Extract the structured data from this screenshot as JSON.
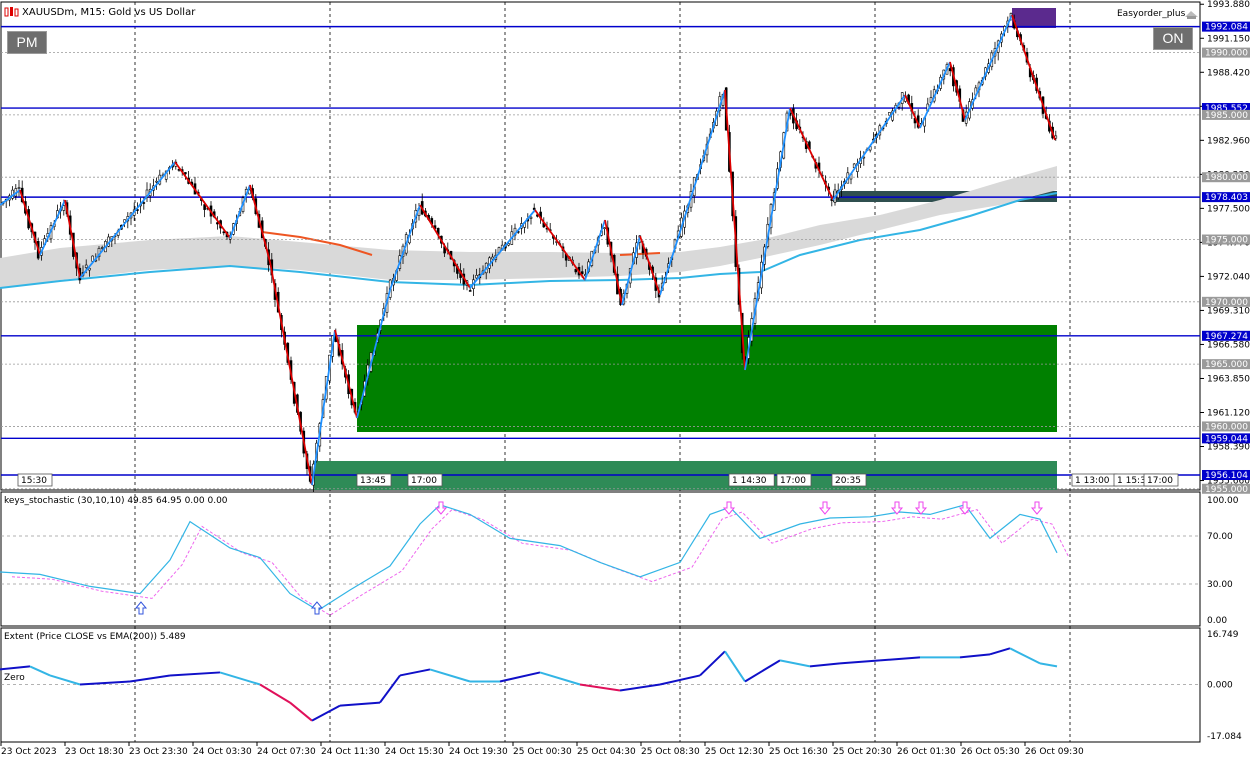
{
  "window": {
    "title": "XAUUSDm, M15:  Gold vs US Dollar",
    "expert": "Easyorder_plus",
    "pm_button": "PM",
    "on_button": "ON"
  },
  "colors": {
    "bull_candle": "#000000",
    "bear_candle": "#000000",
    "zigzag_up": "#1e90ff",
    "zigzag_down": "#dd0000",
    "level_line": "#0000cc",
    "demand_zone": "#008000",
    "demand_zone2": "#2e8b57",
    "supply_zone": "#5b2a8e",
    "zone_dark": "#2f4f4f",
    "ema": "#33b5e5",
    "stoch_main": "#33b5e5",
    "stoch_signal": "#ee66ee",
    "extent_up": "#1010c8",
    "extent_mid": "#33b5e5",
    "extent_down": "#e0105a"
  },
  "price_axis": {
    "labels": [
      "1993.880",
      "1991.150",
      "1988.420",
      "1985.690",
      "1982.960",
      "1980.230",
      "1977.500",
      "1974.770",
      "1972.040",
      "1969.310",
      "1966.580",
      "1963.850",
      "1961.120",
      "1958.390",
      "1955.660"
    ],
    "marked_levels": [
      {
        "price": "1992.084",
        "style": "blue"
      },
      {
        "price": "1990.000",
        "style": "gray"
      },
      {
        "price": "1985.552",
        "style": "blue"
      },
      {
        "price": "1985.000",
        "style": "gray"
      },
      {
        "price": "1980.000",
        "style": "gray"
      },
      {
        "price": "1978.403",
        "style": "blue"
      },
      {
        "price": "1975.000",
        "style": "gray"
      },
      {
        "price": "1970.000",
        "style": "gray"
      },
      {
        "price": "1967.274",
        "style": "blue"
      },
      {
        "price": "1965.000",
        "style": "gray"
      },
      {
        "price": "1960.000",
        "style": "gray"
      },
      {
        "price": "1959.044",
        "style": "blue"
      },
      {
        "price": "1956.104",
        "style": "blue"
      },
      {
        "price": "1955.000",
        "style": "gray"
      }
    ]
  },
  "time_axis": [
    "23 Oct 2023",
    "23 Oct 18:30",
    "23 Oct 23:30",
    "24 Oct 03:30",
    "24 Oct 07:30",
    "24 Oct 11:30",
    "24 Oct 15:30",
    "24 Oct 19:30",
    "25 Oct 00:30",
    "25 Oct 04:30",
    "25 Oct 08:30",
    "25 Oct 12:30",
    "25 Oct 16:30",
    "25 Oct 20:30",
    "26 Oct 01:30",
    "26 Oct 05:30",
    "26 Oct 09:30"
  ],
  "session_tags": [
    "15:30",
    "13:45",
    "17:00",
    "1 14:30",
    "17:00",
    "20:35",
    "1 13:00",
    "1 15:30",
    "17:00"
  ],
  "stochastic": {
    "label": "keys_stochastic (30,10,10) 49.85 64.95 0.00 0.00",
    "levels": [
      "100.00",
      "70.00",
      "30.00",
      "0.00"
    ]
  },
  "extent": {
    "label": "Extent (Price CLOSE vs EMA(200)) 5.489",
    "zero_label": "Zero",
    "levels": [
      "16.749",
      "0.000",
      "-17.084"
    ]
  }
}
